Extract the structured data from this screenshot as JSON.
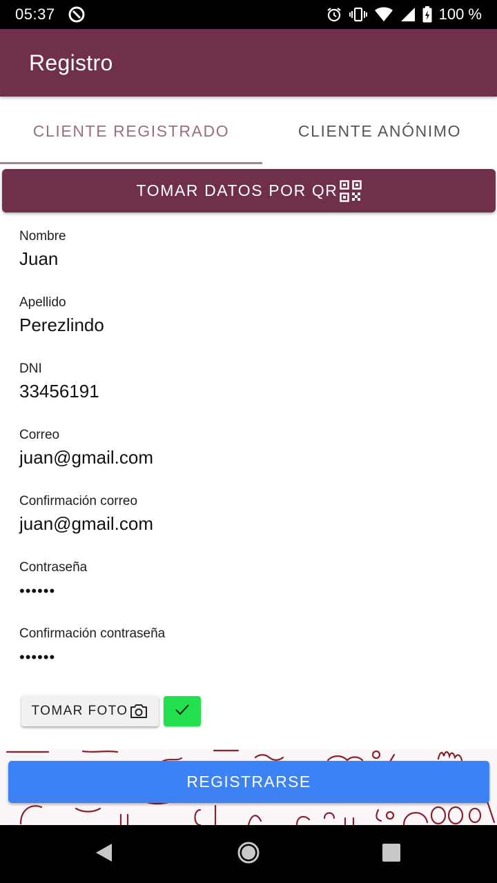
{
  "status_bar": {
    "time": "05:37",
    "battery": "100 %",
    "icons": [
      "data-saver-icon",
      "alarm-icon",
      "vibrate-icon",
      "wifi-icon",
      "signal-icon",
      "battery-charging-icon"
    ]
  },
  "app_bar": {
    "title": "Registro"
  },
  "tabs": [
    {
      "label": "CLIENTE REGISTRADO",
      "selected": true
    },
    {
      "label": "CLIENTE ANÓNIMO",
      "selected": false
    }
  ],
  "qr_button": {
    "label": "TOMAR DATOS POR QR",
    "icon": "qr-code-icon"
  },
  "form": {
    "fields": [
      {
        "label": "Nombre",
        "value": "Juan"
      },
      {
        "label": "Apellido",
        "value": "Perezlindo"
      },
      {
        "label": "DNI",
        "value": "33456191"
      },
      {
        "label": "Correo",
        "value": "juan@gmail.com"
      },
      {
        "label": "Confirmación correo",
        "value": "juan@gmail.com"
      },
      {
        "label": "Contraseña",
        "value": "••••••"
      },
      {
        "label": "Confirmación contraseña",
        "value": "••••••"
      }
    ]
  },
  "photo": {
    "button_label": "TOMAR FOTO",
    "icon": "camera-icon",
    "status_icon": "check-icon"
  },
  "register_button": {
    "label": "REGISTRARSE"
  },
  "nav_bar": {
    "icons": [
      "back-icon",
      "home-icon",
      "recents-icon"
    ]
  },
  "colors": {
    "primary": "#70304c",
    "tab_selected": "#9b6d81",
    "register": "#3d82f5",
    "check": "#22e04e"
  }
}
